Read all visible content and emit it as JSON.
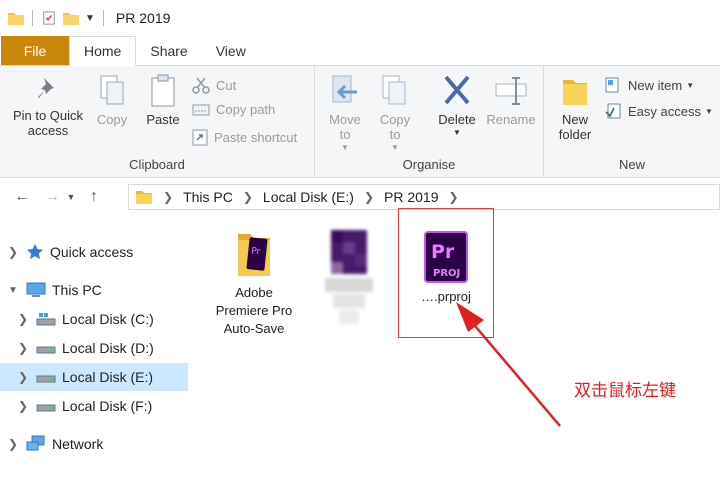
{
  "window": {
    "title": "PR 2019"
  },
  "tabs": {
    "file": "File",
    "home": "Home",
    "share": "Share",
    "view": "View"
  },
  "ribbon": {
    "clipboard": {
      "label": "Clipboard",
      "pin": "Pin to Quick access",
      "copy": "Copy",
      "paste": "Paste",
      "cut": "Cut",
      "copy_path": "Copy path",
      "paste_shortcut": "Paste shortcut"
    },
    "organise": {
      "label": "Organise",
      "move_to": "Move to",
      "copy_to": "Copy to",
      "delete": "Delete",
      "rename": "Rename"
    },
    "new": {
      "label": "New",
      "new_folder": "New folder",
      "new_item": "New item",
      "easy_access": "Easy access"
    }
  },
  "address": {
    "crumbs": [
      "This PC",
      "Local Disk (E:)",
      "PR 2019"
    ]
  },
  "sidebar": {
    "items": [
      {
        "label": "Quick access"
      },
      {
        "label": "This PC"
      },
      {
        "label": "Local Disk (C:)"
      },
      {
        "label": "Local Disk (D:)"
      },
      {
        "label": "Local Disk (E:)"
      },
      {
        "label": "Local Disk (F:)"
      },
      {
        "label": "Network"
      }
    ]
  },
  "files": [
    {
      "name": "Adobe Premiere Pro Auto-Save",
      "icon": "premiere-folder-icon"
    },
    {
      "name": "",
      "icon": "blurred-image-icon"
    },
    {
      "name": "….prproj",
      "icon": "premiere-project-icon",
      "badge": "PROJ",
      "logo": "Pr"
    }
  ],
  "annotation": {
    "text": "双击鼠标左键"
  },
  "colors": {
    "file_tab": "#c8860a",
    "selected": "#cce8ff",
    "premiere": "#2a0046",
    "premiere_accent": "#e77cff",
    "annotation": "#e02020"
  }
}
